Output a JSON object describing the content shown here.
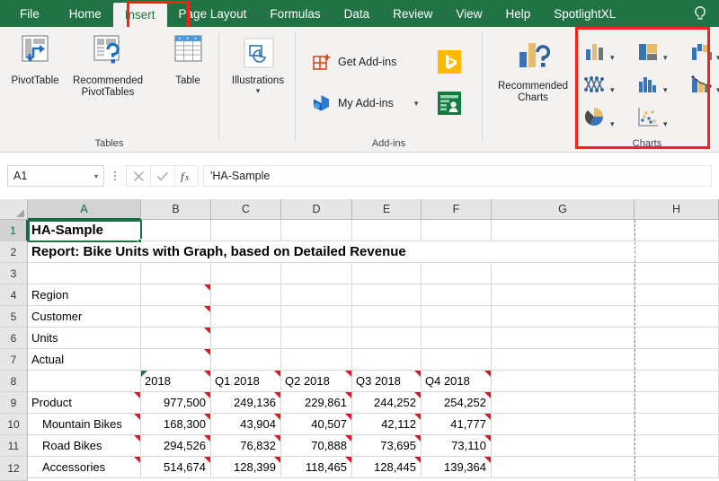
{
  "app": {
    "accent_green": "#217346",
    "highlight_red": "#ff2015",
    "ribbon_bg": "#f3f2f1"
  },
  "tabs": [
    {
      "label": "File",
      "active": false
    },
    {
      "label": "Home",
      "active": false
    },
    {
      "label": "Insert",
      "active": true
    },
    {
      "label": "Page Layout",
      "active": false
    },
    {
      "label": "Formulas",
      "active": false
    },
    {
      "label": "Data",
      "active": false
    },
    {
      "label": "Review",
      "active": false
    },
    {
      "label": "View",
      "active": false
    },
    {
      "label": "Help",
      "active": false
    },
    {
      "label": "SpotlightXL",
      "active": false
    }
  ],
  "tellme": {
    "icon": "lightbulb-icon"
  },
  "ribbon": {
    "groups": [
      {
        "name": "Tables",
        "label": "Tables",
        "buttons": [
          {
            "label": "PivotTable",
            "icon": "pivottable-icon"
          },
          {
            "label": "Recommended PivotTables",
            "icon": "recommended-pivottables-icon"
          },
          {
            "label": "Table",
            "icon": "table-icon"
          }
        ]
      },
      {
        "name": "Illustrations",
        "label": "",
        "buttons": [
          {
            "label": "Illustrations",
            "icon": "illustrations-icon",
            "caret": "▾"
          }
        ]
      },
      {
        "name": "Add-ins",
        "label": "Add-ins",
        "buttons": [
          {
            "label": "Get Add-ins",
            "icon": "get-addins-icon"
          },
          {
            "label": "My Add-ins",
            "icon": "my-addins-icon",
            "caret": "▾"
          },
          {
            "label": "Bing Maps",
            "icon": "bing-icon"
          },
          {
            "label": "People Graph",
            "icon": "people-graph-icon"
          }
        ]
      },
      {
        "name": "Charts",
        "label": "Charts",
        "buttons": [
          {
            "label": "Recommended Charts",
            "icon": "recommended-charts-icon"
          }
        ],
        "chart_icons": [
          {
            "name": "column-bar-chart-icon"
          },
          {
            "name": "hierarchy-chart-icon"
          },
          {
            "name": "waterfall-chart-icon"
          },
          {
            "name": "line-scatter-chart-icon"
          },
          {
            "name": "statistic-chart-icon"
          },
          {
            "name": "combo-chart-icon"
          },
          {
            "name": "pie-doughnut-chart-icon"
          },
          {
            "name": "scatter-bubble-chart-icon"
          }
        ]
      }
    ]
  },
  "formula_bar": {
    "name_box": "A1",
    "name_box_caret": "▾",
    "cancel_icon": "x-icon",
    "enter_icon": "check-icon",
    "function_icon": "fx-icon",
    "formula": "'HA-Sample"
  },
  "sheet": {
    "columns": [
      "A",
      "B",
      "C",
      "D",
      "E",
      "F",
      "G",
      "H"
    ],
    "selected_column": "A",
    "selected_row": "1",
    "rows": [
      "1",
      "2",
      "3",
      "4",
      "5",
      "6",
      "7",
      "8",
      "9",
      "10",
      "11",
      "12"
    ],
    "cells": {
      "A1": "HA-Sample",
      "A2": "Report: Bike Units with Graph, based on Detailed Revenue",
      "A4": "Region",
      "A5": "Customer",
      "A6": "Units",
      "A7": "Actual",
      "A9": "Product",
      "A10": "Mountain Bikes",
      "A11": "Road Bikes",
      "A12": "Accessories",
      "B8": "2018",
      "C8": "Q1 2018",
      "D8": "Q2 2018",
      "E8": "Q3 2018",
      "F8": "Q4 2018",
      "B9": "977,500",
      "C9": "249,136",
      "D9": "229,861",
      "E9": "244,252",
      "F9": "254,252",
      "B10": "168,300",
      "C10": "43,904",
      "D10": "40,507",
      "E10": "42,112",
      "F10": "41,777",
      "B11": "294,526",
      "C11": "76,832",
      "D11": "70,888",
      "E11": "73,695",
      "F11": "73,110",
      "B12": "514,674",
      "C12": "128,399",
      "D12": "118,465",
      "E12": "128,445",
      "F12": "139,364"
    }
  }
}
